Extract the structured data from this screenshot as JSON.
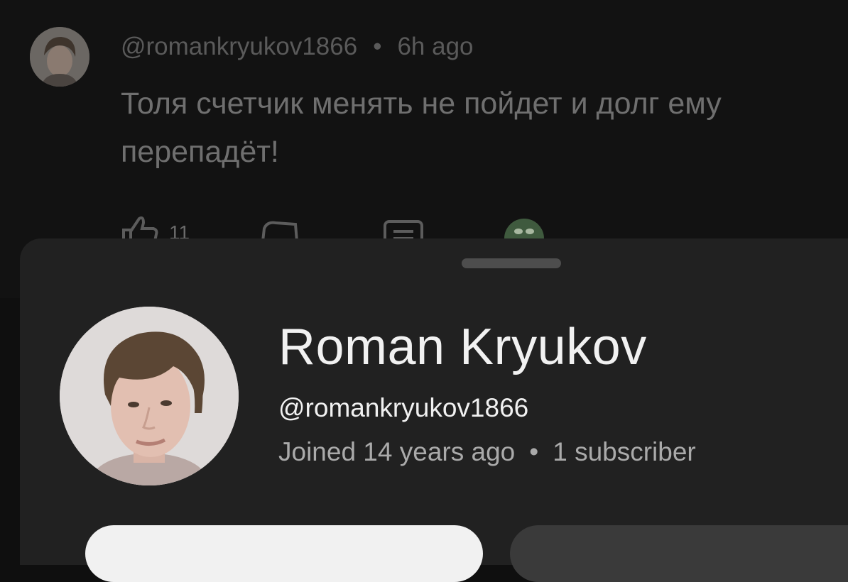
{
  "comment": {
    "author_handle": "@romankryukov1866",
    "separator": "•",
    "time": "6h ago",
    "text": "Толя счетчик менять не пойдет и долг ему перепадёт!",
    "like_count": "11"
  },
  "profile_sheet": {
    "name": "Roman Kryukov",
    "handle": "@romankryukov1866",
    "joined": "Joined 14 years ago",
    "separator": "•",
    "subscribers": "1 subscriber"
  },
  "colors": {
    "background": "#0f0f0f",
    "sheet": "#212121",
    "primary_text": "#f1f1f1",
    "secondary_text": "#aaaaaa"
  },
  "icons": [
    "thumb-up-icon",
    "thumb-down-icon",
    "reply-icon",
    "creator-heart-avatar-icon",
    "drag-handle"
  ]
}
